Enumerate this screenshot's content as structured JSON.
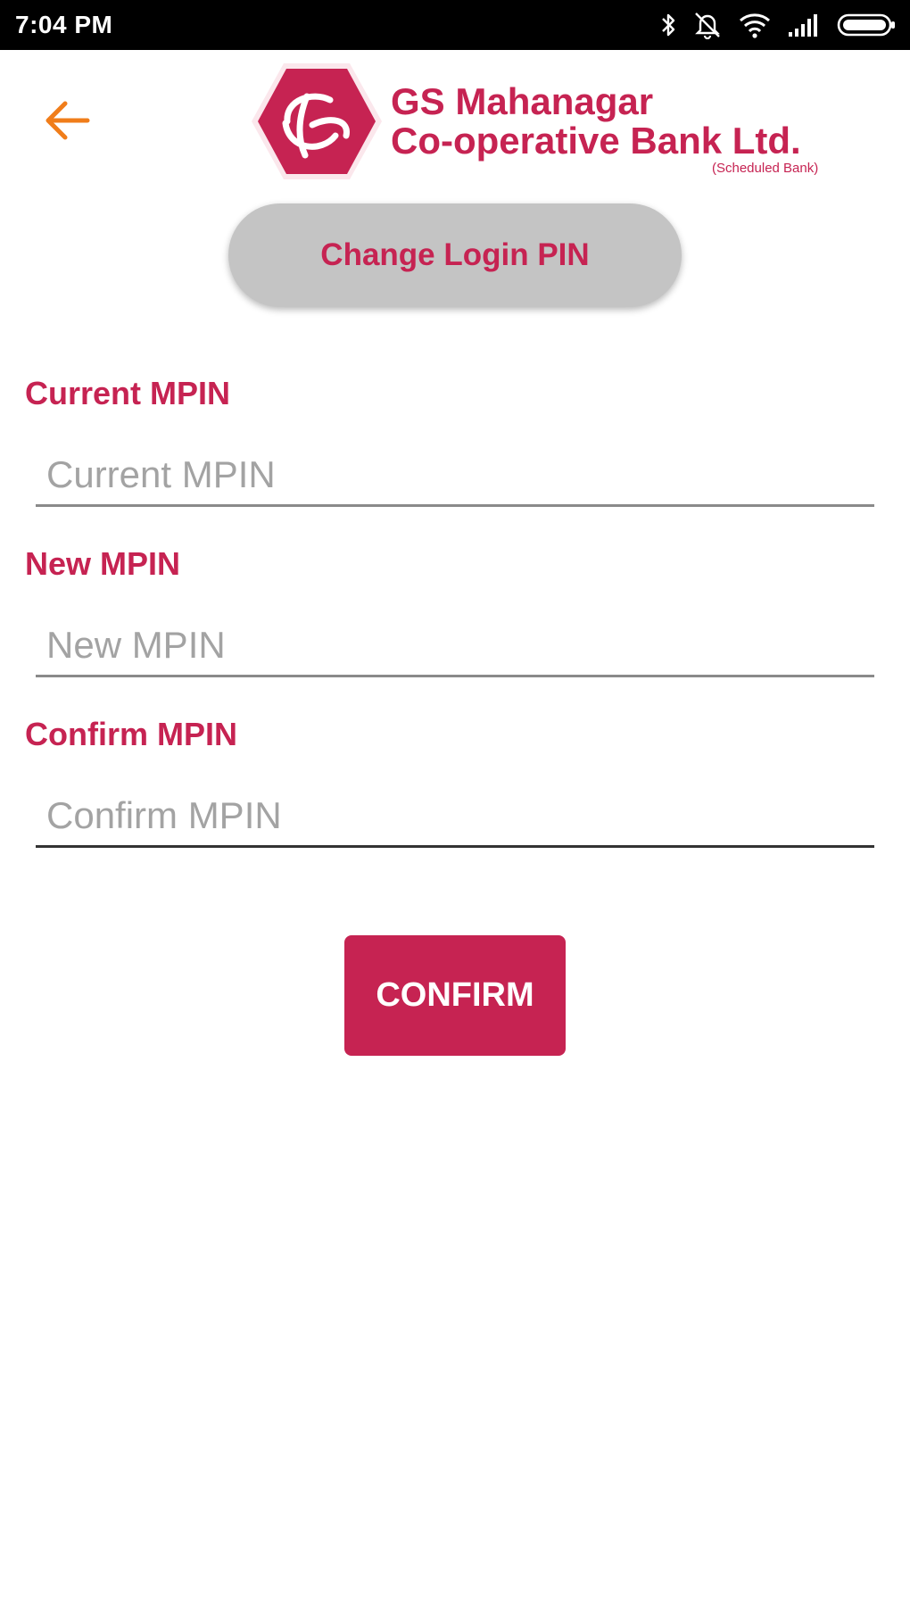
{
  "status_bar": {
    "time": "7:04 PM",
    "icons": [
      "bluetooth-icon",
      "alarm-off-icon",
      "wifi-icon",
      "signal-icon",
      "battery-icon"
    ]
  },
  "header": {
    "back_icon": "arrow-left-icon",
    "logo": {
      "monogram": "GS",
      "line1": "GS Mahanagar",
      "line2": "Co-operative Bank Ltd.",
      "subtitle": "(Scheduled Bank)"
    }
  },
  "page_title": "Change Login PIN",
  "form": {
    "fields": [
      {
        "label": "Current MPIN",
        "placeholder": "Current MPIN",
        "value": ""
      },
      {
        "label": "New MPIN",
        "placeholder": "New MPIN",
        "value": ""
      },
      {
        "label": "Confirm MPIN",
        "placeholder": "Confirm MPIN",
        "value": ""
      }
    ],
    "submit_label": "CONFIRM"
  },
  "colors": {
    "brand": "#c62352",
    "back_arrow": "#f07d1a",
    "pill_background": "#c4c4c4",
    "status_bar": "#000000"
  }
}
